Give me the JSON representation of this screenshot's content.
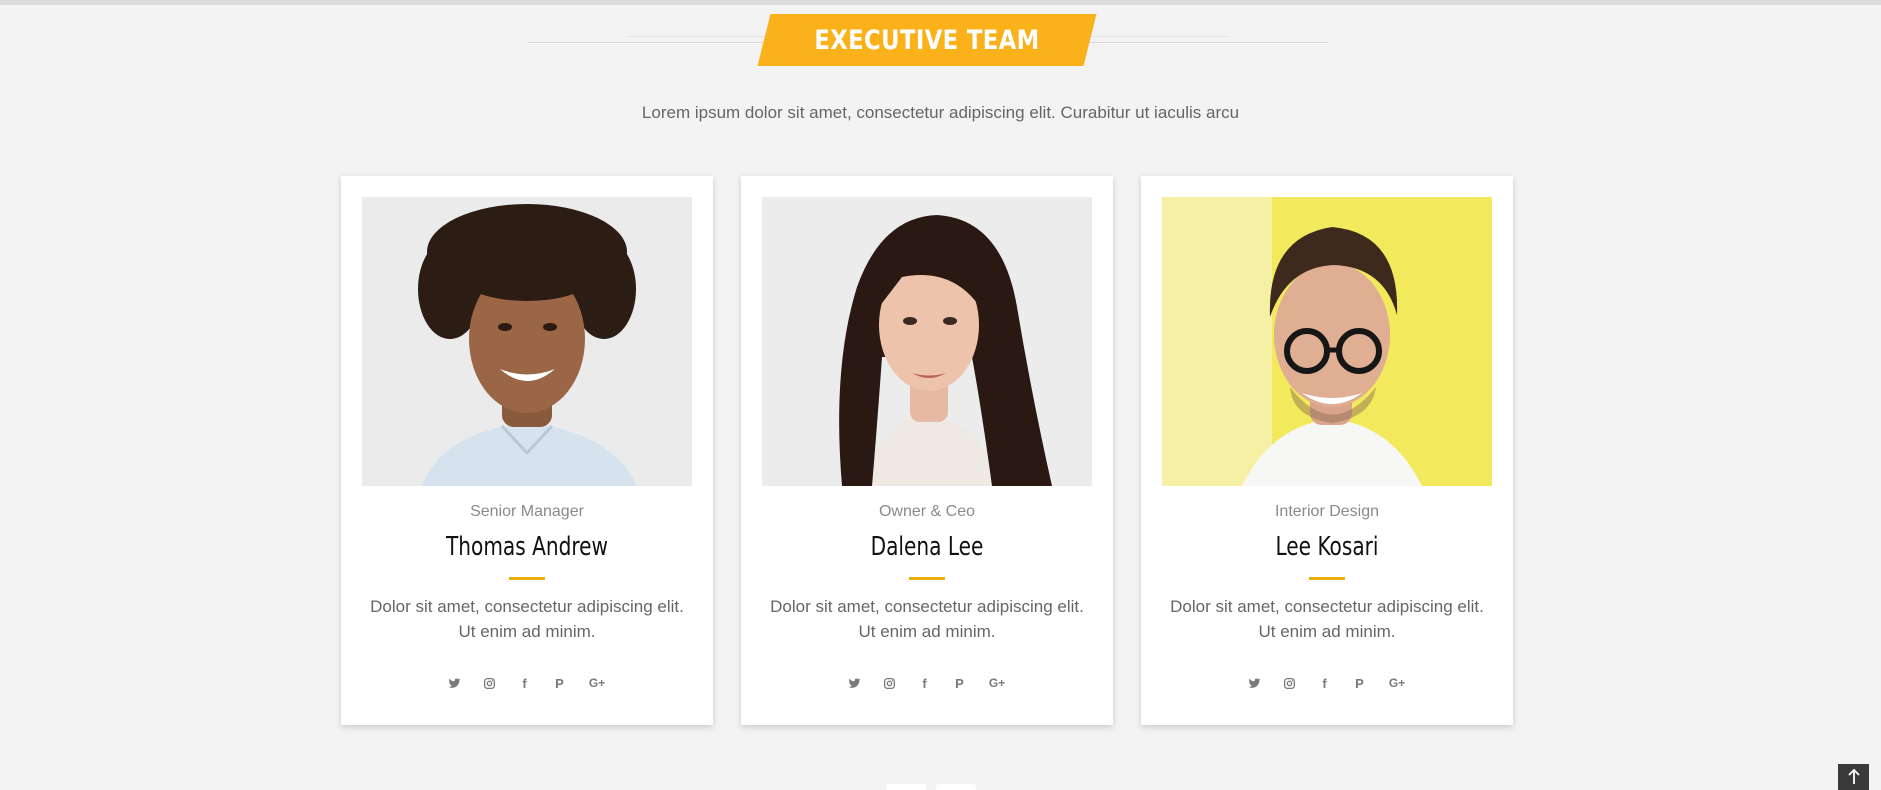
{
  "section": {
    "title": "EXECUTIVE TEAM",
    "intro": "Lorem ipsum dolor sit amet, consectetur adipiscing elit. Curabitur ut iaculis arcu"
  },
  "team": [
    {
      "role": "Senior Manager",
      "name": "Thomas Andrew",
      "description": "Dolor sit amet, consectetur adipiscing elit. Ut enim ad minim."
    },
    {
      "role": "Owner & Ceo",
      "name": "Dalena Lee",
      "description": "Dolor sit amet, consectetur adipiscing elit. Ut enim ad minim."
    },
    {
      "role": "Interior Design",
      "name": "Lee Kosari",
      "description": "Dolor sit amet, consectetur adipiscing elit. Ut enim ad minim."
    }
  ],
  "social_icons": [
    "twitter-icon",
    "instagram-icon",
    "facebook-icon",
    "pinterest-icon",
    "google-plus-icon"
  ],
  "social_glyphs": {
    "facebook": "f",
    "pinterest": "P",
    "google_plus": "G+"
  },
  "colors": {
    "accent": "#fbb11a",
    "underline": "#e8b011",
    "background": "#f3f3f3",
    "card": "#ffffff"
  }
}
